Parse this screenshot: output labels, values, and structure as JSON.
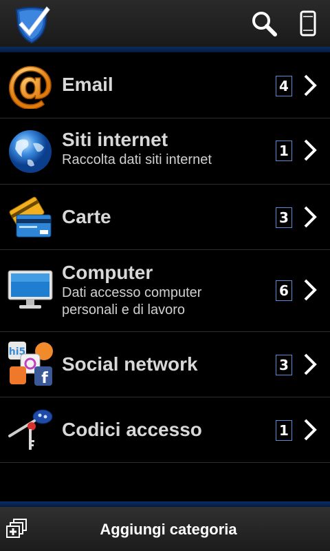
{
  "header": {
    "icons": [
      "app-logo-shield-check-icon",
      "search-icon",
      "phone-icon"
    ]
  },
  "categories": [
    {
      "title": "Email",
      "subtitle": "",
      "count": "4",
      "icon": "email-at-icon"
    },
    {
      "title": "Siti internet",
      "subtitle": "Raccolta dati siti internet",
      "count": "1",
      "icon": "globe-icon"
    },
    {
      "title": "Carte",
      "subtitle": "",
      "count": "3",
      "icon": "credit-cards-icon"
    },
    {
      "title": "Computer",
      "subtitle_line1": "Dati accesso computer",
      "subtitle_line2": "personali e di lavoro",
      "count": "6",
      "icon": "monitor-icon"
    },
    {
      "title": "Social network",
      "subtitle": "",
      "count": "3",
      "icon": "social-network-icon"
    },
    {
      "title": "Codici accesso",
      "subtitle": "",
      "count": "1",
      "icon": "keys-icon"
    }
  ],
  "footer": {
    "add_label": "Aggiungi categoria",
    "add_icon": "add-category-icon"
  },
  "colors": {
    "accent_line": "#0b2d66",
    "badge_border": "#5a8cd8"
  }
}
